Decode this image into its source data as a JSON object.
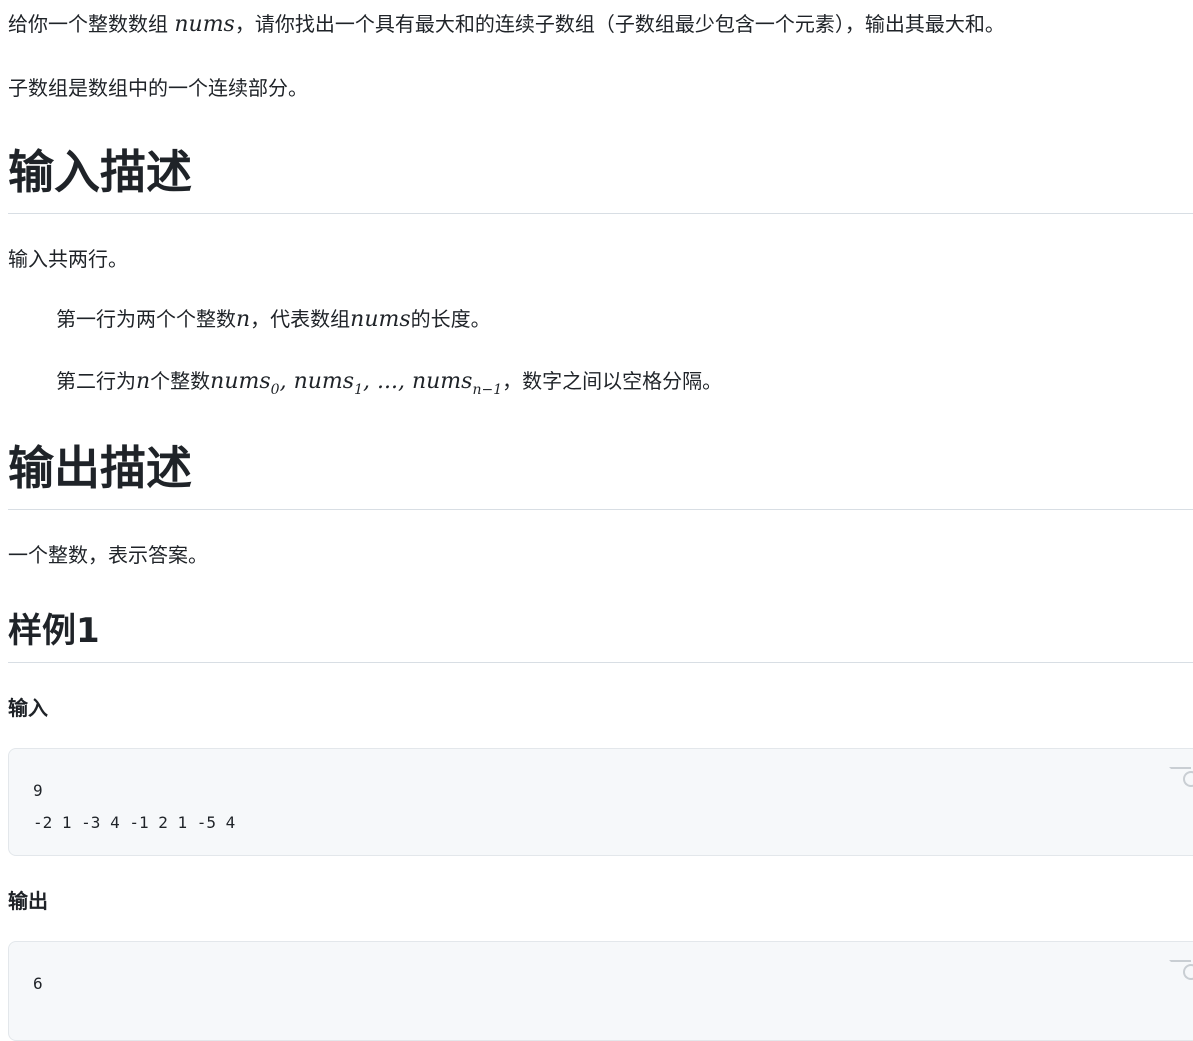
{
  "intro": {
    "line1_a": "给你一个整数数组 ",
    "line1_var": "nums",
    "line1_b": "，请你找出一个具有最大和的连续子数组（子数组最少包含一个元素），输出其最大和。",
    "line2": "子数组是数组中的一个连续部分。"
  },
  "input_section": {
    "heading": "输入描述",
    "summary": "输入共两行。",
    "row1_a": "第一行为两个个整数",
    "row1_var_n": "n",
    "row1_b": "，代表数组",
    "row1_var_nums": "nums",
    "row1_c": "的长度。",
    "row2_a": "第二行为",
    "row2_var_n": "n",
    "row2_b": "个整数",
    "row2_nums_a": "nums",
    "row2_sub_a": "0",
    "row2_sep_a": ", ",
    "row2_nums_b": "nums",
    "row2_sub_b": "1",
    "row2_sep_b": ", ..., ",
    "row2_nums_c": "nums",
    "row2_sub_c": "n−1",
    "row2_c": "，数字之间以空格分隔。"
  },
  "output_section": {
    "heading": "输出描述",
    "text": "一个整数，表示答案。"
  },
  "example": {
    "heading": "样例1",
    "input_label": "输入",
    "input_code": "9\n-2 1 -3 4 -1 2 1 -5 4",
    "output_label": "输出",
    "output_code": "6"
  }
}
